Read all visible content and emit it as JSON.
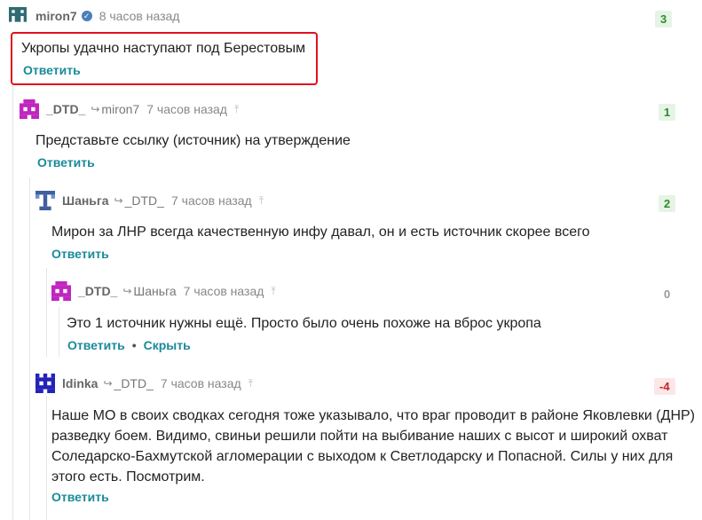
{
  "colors": {
    "accent": "#1a8a9a",
    "highlight": "#e0101e",
    "positive": "#2e8b2e",
    "negative": "#cc2222"
  },
  "comments": [
    {
      "author": "miron7",
      "verified": true,
      "time": "8 часов назад",
      "score": "3",
      "text": "Укропы удачно наступают под Берестовым",
      "reply_label": "Ответить"
    },
    {
      "author": "_DTD_",
      "reply_to": "miron7",
      "time": "7 часов назад",
      "score": "1",
      "text": "Представьте ссылку (источник) на утверждение",
      "reply_label": "Ответить"
    },
    {
      "author": "Шаньга",
      "reply_to": "_DTD_",
      "time": "7 часов назад",
      "score": "2",
      "text": "Мирон за ЛНР всегда качественную инфу давал, он и есть источник скорее всего",
      "reply_label": "Ответить"
    },
    {
      "author": "_DTD_",
      "reply_to": "Шаньга",
      "time": "7 часов назад",
      "score": "0",
      "text": "Это 1 источник нужны ещё. Просто было очень похоже на вброс укропа",
      "reply_label": "Ответить",
      "hide_label": "Скрыть"
    },
    {
      "author": "ldinka",
      "reply_to": "_DTD_",
      "time": "7 часов назад",
      "score": "-4",
      "text": "Наше МО в своих сводках сегодня тоже указывало, что враг проводит в районе Яковлевки (ДНР) разведку боем. Видимо, свиньи решили пойти на выбивание наших с высот и широкий охват Соледарско-Бахмутской агломерации с выходом к Светлодарску и Попасной. Силы у них для этого есть. Посмотрим.",
      "reply_label": "Ответить"
    }
  ]
}
